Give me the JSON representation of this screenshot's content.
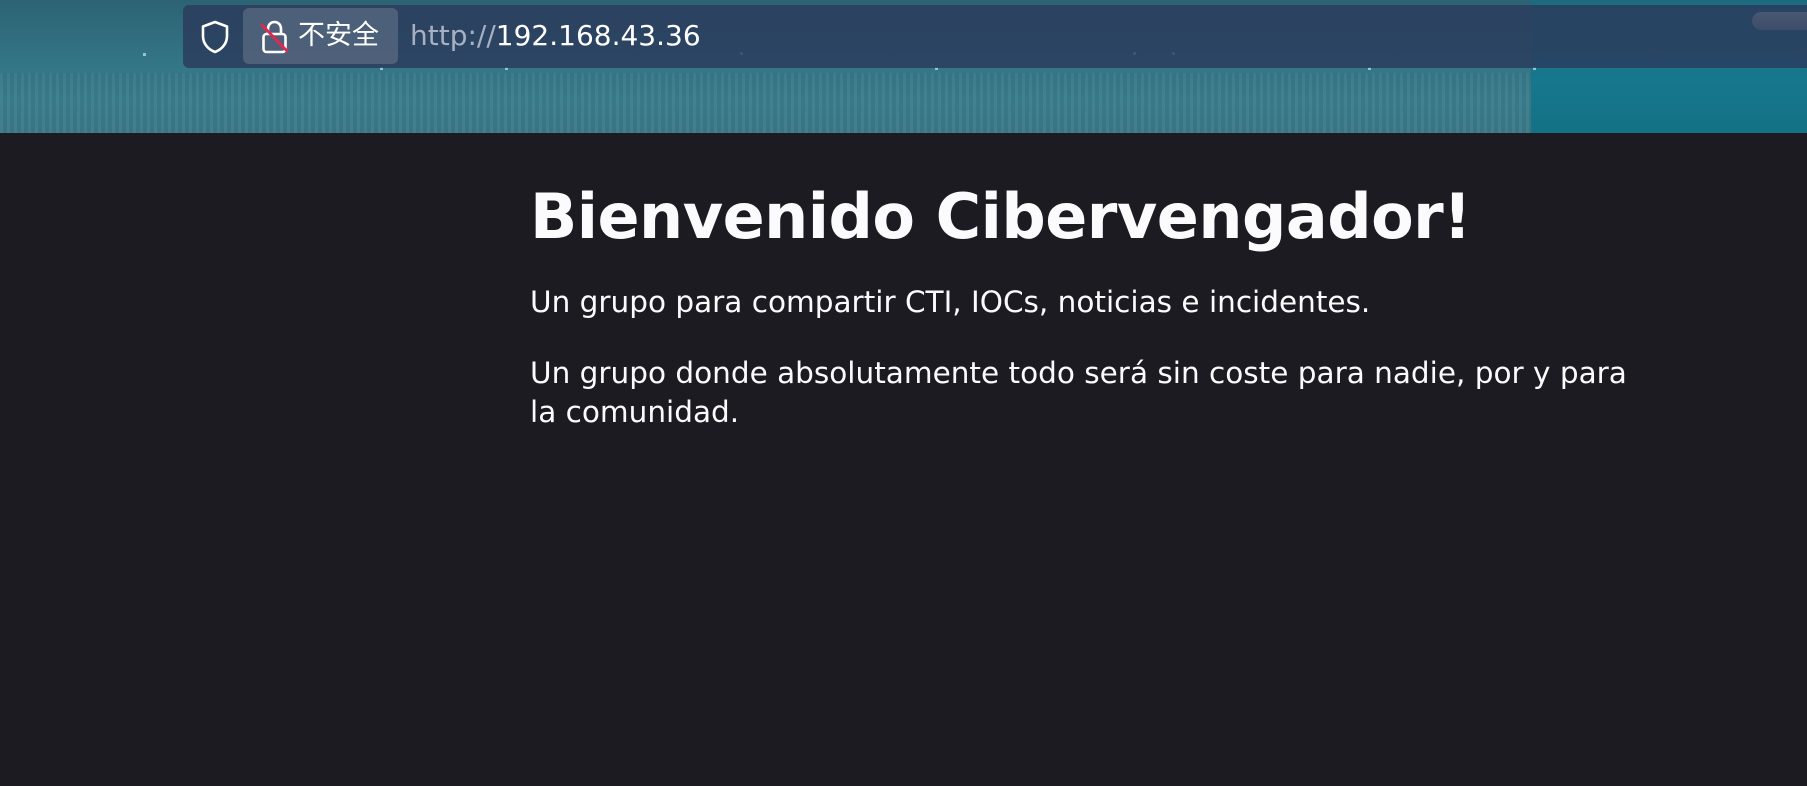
{
  "browser": {
    "security_label": "不安全",
    "url_scheme": "http://",
    "url_host": "192.168.43.36",
    "icons": [
      "shield-icon",
      "insecure-lock-icon"
    ]
  },
  "page": {
    "heading": "Bienvenido Cibervengador!",
    "paragraphs": [
      "Un grupo para compartir CTI, IOCs, noticias e incidentes.",
      "Un grupo donde absolutamente todo será sin coste para nadie, por y para la comunidad."
    ]
  },
  "colors": {
    "page_background": "#1c1b22",
    "text": "#fbfbfe",
    "chrome_background": "#337485",
    "urlbar_background": "#2b3a5c",
    "insecure_slash": "#e22850"
  }
}
